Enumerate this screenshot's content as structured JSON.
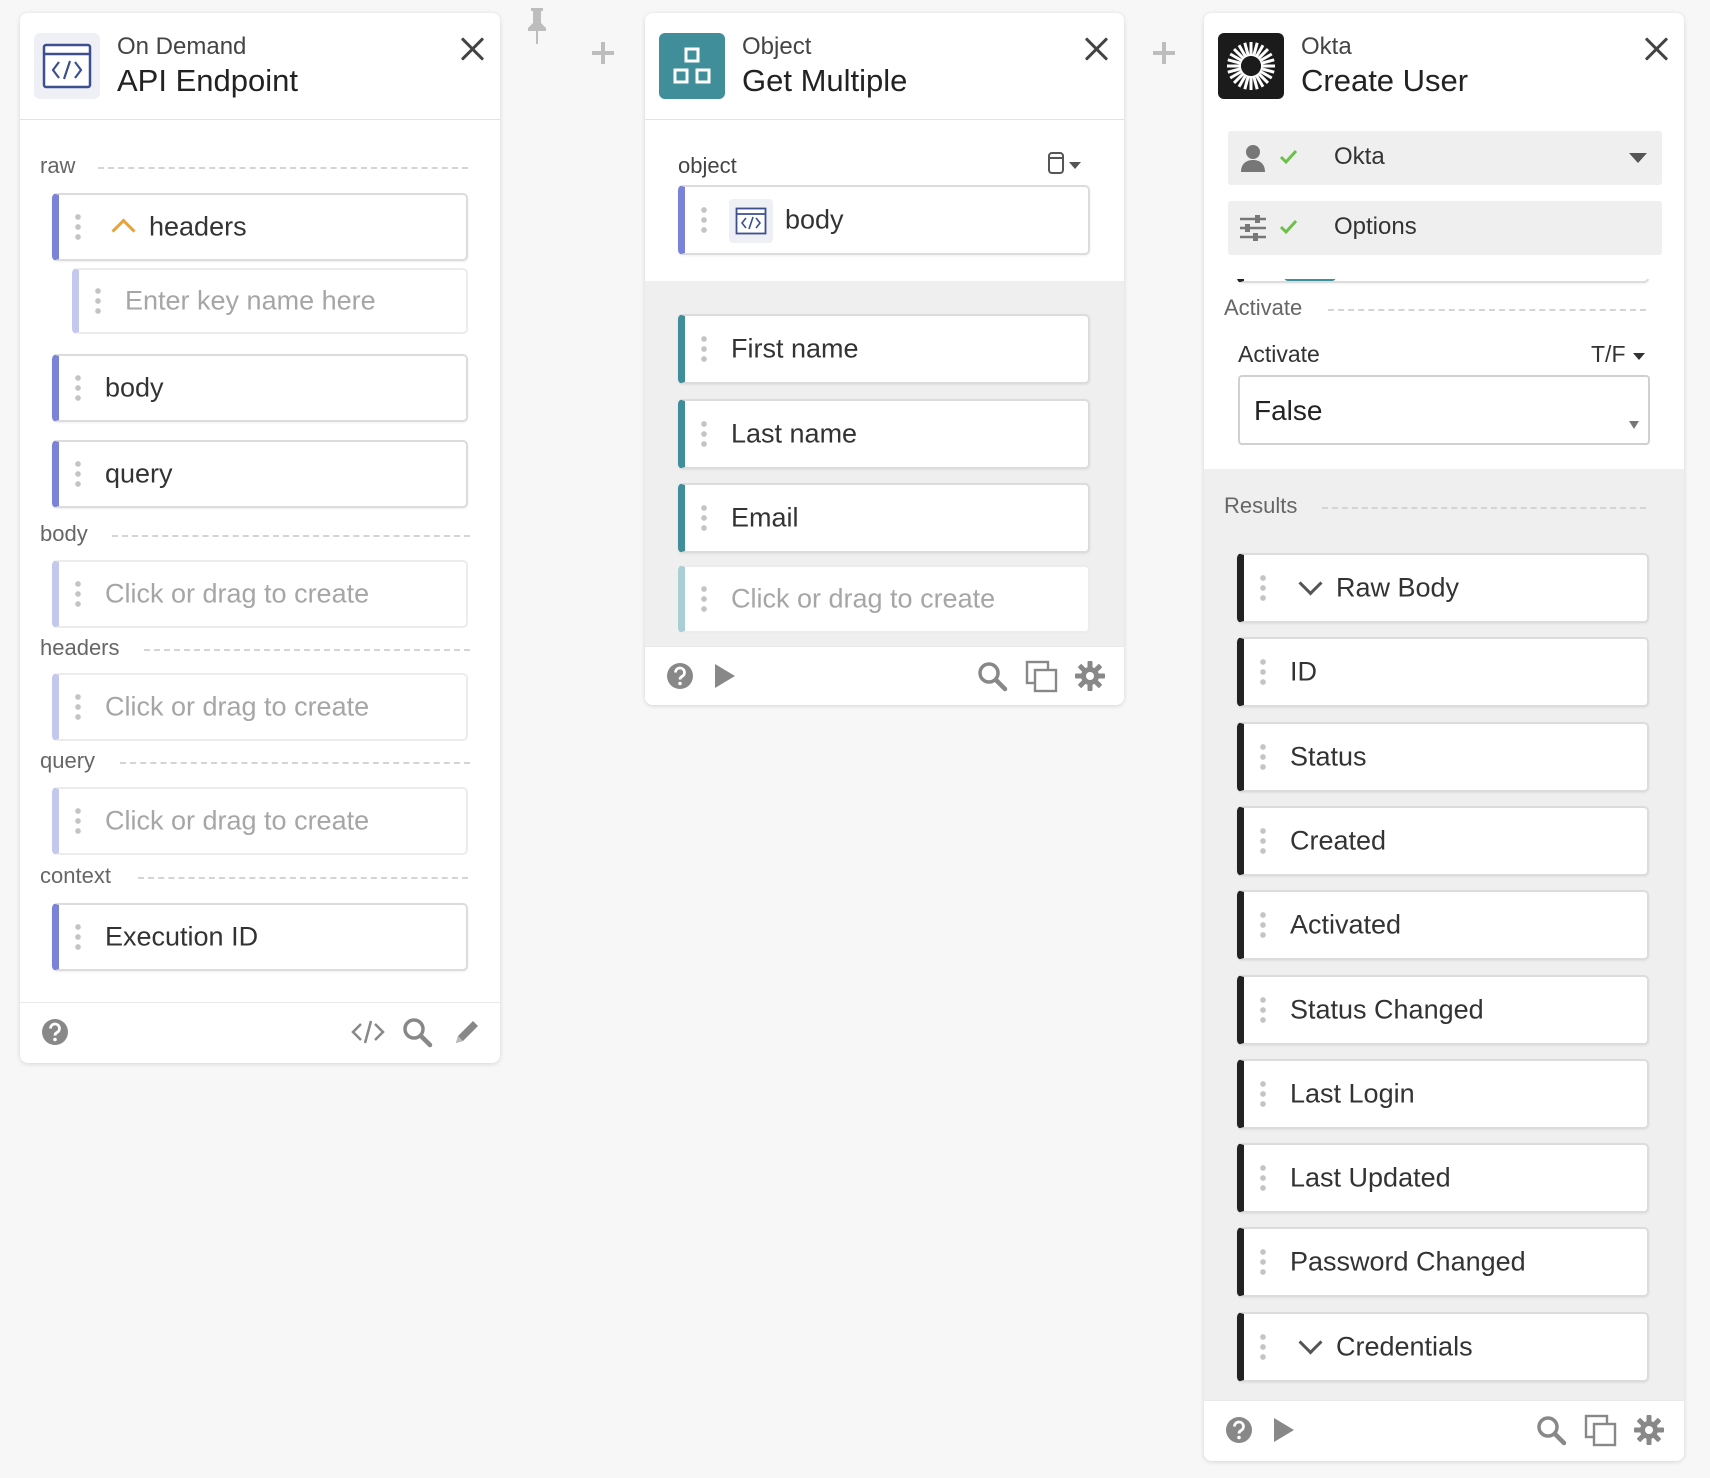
{
  "cards": {
    "api": {
      "subtitle": "On Demand",
      "title": "API Endpoint",
      "sections": {
        "raw": "raw",
        "body": "body",
        "headers": "headers",
        "query": "query",
        "context": "context"
      },
      "raw_items": {
        "headers": "headers",
        "key_placeholder": "Enter key name here",
        "body": "body",
        "query": "query"
      },
      "body_create": "Click or drag to create",
      "headers_create": "Click or drag to create",
      "query_create": "Click or drag to create",
      "execution_id": "Execution ID"
    },
    "object": {
      "subtitle": "Object",
      "title": "Get Multiple",
      "object_label": "object",
      "body_input": "body",
      "fields": [
        "First name",
        "Last name",
        "Email"
      ],
      "create": "Click or drag to create"
    },
    "okta": {
      "subtitle": "Okta",
      "title": "Create User",
      "account_label": "Okta",
      "options_label": "Options",
      "activate_section": "Activate",
      "activate_label": "Activate",
      "activate_type": "T/F",
      "activate_value": "False",
      "results_section": "Results",
      "results": [
        "Raw Body",
        "ID",
        "Status",
        "Created",
        "Activated",
        "Status Changed",
        "Last Login",
        "Last Updated",
        "Password Changed",
        "Credentials"
      ]
    }
  },
  "colors": {
    "api_accent": "#7b83d9",
    "object_accent": "#3f8e9a",
    "okta_accent": "#222222",
    "check_green": "#6cc04a",
    "chevron_orange": "#e6a33a"
  },
  "icons": {
    "api_header": "code-window-icon",
    "object_header": "object-blocks-icon",
    "okta_header": "okta-sunburst-icon"
  }
}
